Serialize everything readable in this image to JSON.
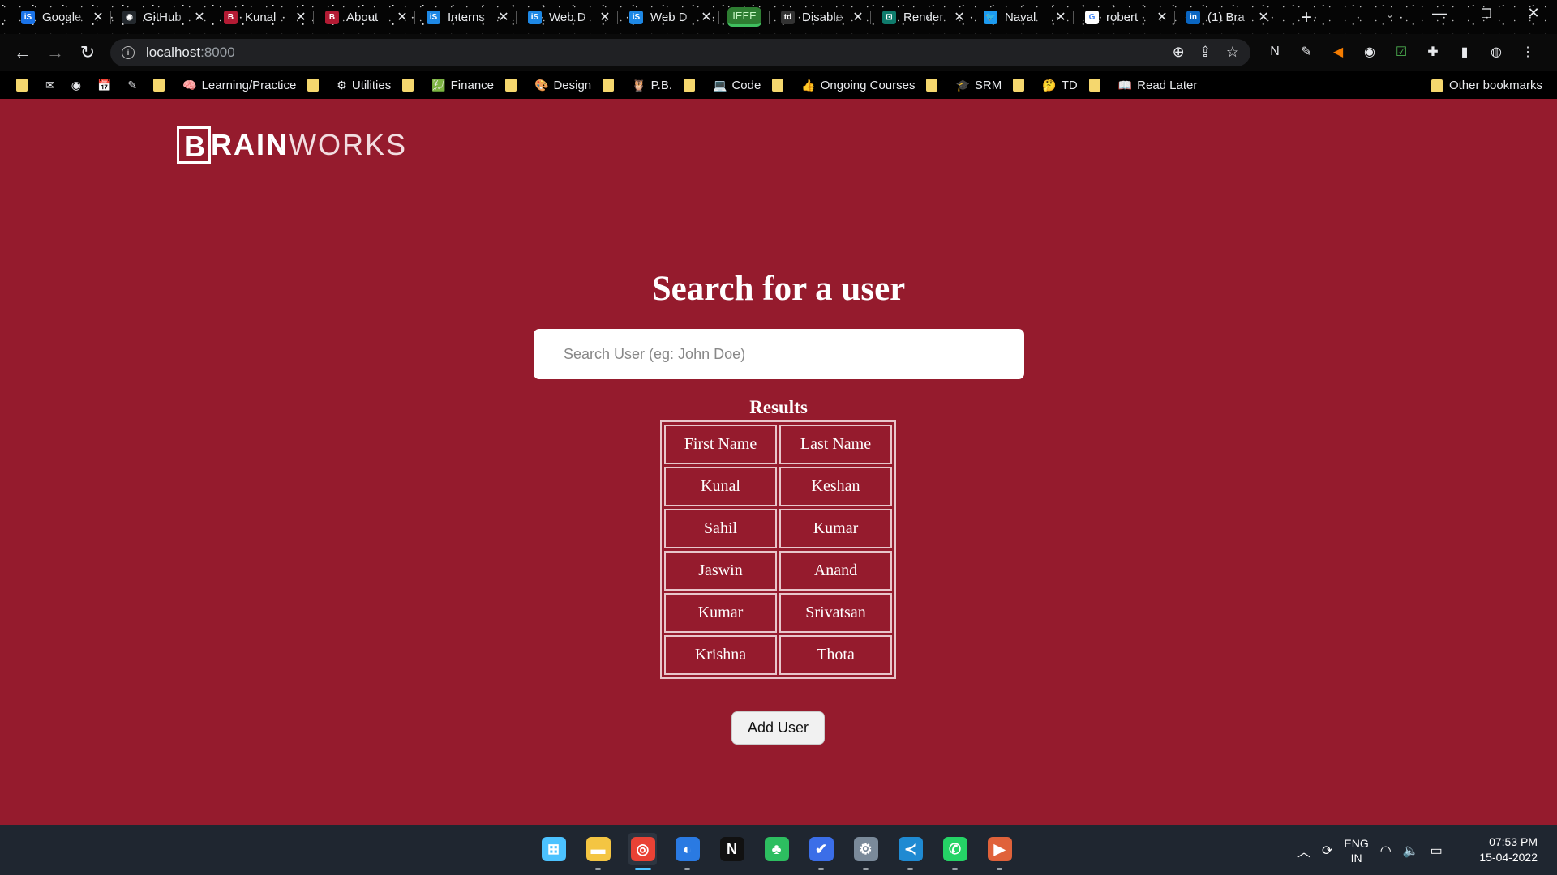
{
  "tabs": [
    {
      "title": "Google",
      "fav": "iS",
      "fav_color": "#1a73e8"
    },
    {
      "title": "GitHub",
      "fav": "◉",
      "fav_color": "#24292e"
    },
    {
      "title": "Kunal",
      "fav": "B",
      "fav_color": "#b31b34"
    },
    {
      "title": "About",
      "fav": "B",
      "fav_color": "#b31b34"
    },
    {
      "title": "Interns",
      "fav": "iS",
      "fav_color": "#1e88e5"
    },
    {
      "title": "Web D",
      "fav": "iS",
      "fav_color": "#1e88e5"
    },
    {
      "title": "Web D",
      "fav": "iS",
      "fav_color": "#1e88e5"
    }
  ],
  "pinned_group": "IEEE",
  "tabs2": [
    {
      "title": "Disable",
      "fav": "td",
      "fav_color": "#333333"
    },
    {
      "title": "Render",
      "fav": "⊡",
      "fav_color": "#0f7b6c"
    },
    {
      "title": "Naval",
      "fav": "🐦",
      "fav_color": "#1d9bf0"
    },
    {
      "title": "robert",
      "fav": "G",
      "fav_color": "#ffffff"
    },
    {
      "title": "(1) Bra",
      "fav": "in",
      "fav_color": "#0a66c2"
    }
  ],
  "address": {
    "host": "localhost",
    "port": ":8000"
  },
  "bookmarks": [
    {
      "label": "",
      "icon": "folder"
    },
    {
      "label": "",
      "icon": "✉"
    },
    {
      "label": "",
      "icon": "◉"
    },
    {
      "label": "",
      "icon": "📅"
    },
    {
      "label": "",
      "icon": "✎"
    },
    {
      "label": "",
      "icon": "folder"
    },
    {
      "label": "Learning/Practice",
      "icon": "🧠"
    },
    {
      "label": "",
      "icon": "folder"
    },
    {
      "label": "Utilities",
      "icon": "⚙"
    },
    {
      "label": "",
      "icon": "folder"
    },
    {
      "label": "Finance",
      "icon": "💹"
    },
    {
      "label": "",
      "icon": "folder"
    },
    {
      "label": "Design",
      "icon": "🎨"
    },
    {
      "label": "",
      "icon": "folder"
    },
    {
      "label": "P.B.",
      "icon": "🦉"
    },
    {
      "label": "",
      "icon": "folder"
    },
    {
      "label": "Code",
      "icon": "💻"
    },
    {
      "label": "",
      "icon": "folder"
    },
    {
      "label": "Ongoing Courses",
      "icon": "👍"
    },
    {
      "label": "",
      "icon": "folder"
    },
    {
      "label": "SRM",
      "icon": "🎓"
    },
    {
      "label": "",
      "icon": "folder"
    },
    {
      "label": "TD",
      "icon": "🤔"
    },
    {
      "label": "",
      "icon": "folder"
    },
    {
      "label": "Read Later",
      "icon": "📖"
    }
  ],
  "other_bookmarks": "Other bookmarks",
  "logo": {
    "boxed": "B",
    "bold": "RAIN",
    "light": "WORKS"
  },
  "heading": "Search for a user",
  "search": {
    "placeholder": "Search User (eg: John Doe)",
    "value": ""
  },
  "results": {
    "caption": "Results",
    "headers": [
      "First Name",
      "Last Name"
    ],
    "rows": [
      [
        "Kunal",
        "Keshan"
      ],
      [
        "Sahil",
        "Kumar"
      ],
      [
        "Jaswin",
        "Anand"
      ],
      [
        "Kumar",
        "Srivatsan"
      ],
      [
        "Krishna",
        "Thota"
      ]
    ]
  },
  "add_button": "Add User",
  "taskbar": {
    "apps": [
      {
        "name": "windows-start-icon",
        "glyph": "⊞",
        "color": "#4cc2ff",
        "active": false,
        "running": false
      },
      {
        "name": "file-explorer-icon",
        "glyph": "▬",
        "color": "#f4c542",
        "active": false,
        "running": true
      },
      {
        "name": "chrome-icon",
        "glyph": "◎",
        "color": "#e94235",
        "active": true,
        "running": true
      },
      {
        "name": "firefox-icon",
        "glyph": "◐",
        "color": "#2a7ae2",
        "active": false,
        "running": true
      },
      {
        "name": "notion-icon",
        "glyph": "N",
        "color": "#111111",
        "active": false,
        "running": false
      },
      {
        "name": "evernote-icon",
        "glyph": "♣",
        "color": "#2dbe60",
        "active": false,
        "running": false
      },
      {
        "name": "todo-icon",
        "glyph": "✔",
        "color": "#3b6ee8",
        "active": false,
        "running": true
      },
      {
        "name": "settings-icon",
        "glyph": "⚙",
        "color": "#7a8a9a",
        "active": false,
        "running": true
      },
      {
        "name": "vscode-icon",
        "glyph": "≺",
        "color": "#1f8ad2",
        "active": false,
        "running": true
      },
      {
        "name": "whatsapp-icon",
        "glyph": "✆",
        "color": "#25d366",
        "active": false,
        "running": true
      },
      {
        "name": "media-player-icon",
        "glyph": "▶",
        "color": "#e0623a",
        "active": false,
        "running": true
      }
    ],
    "lang_top": "ENG",
    "lang_bottom": "IN",
    "time": "07:53 PM",
    "date": "15-04-2022"
  }
}
